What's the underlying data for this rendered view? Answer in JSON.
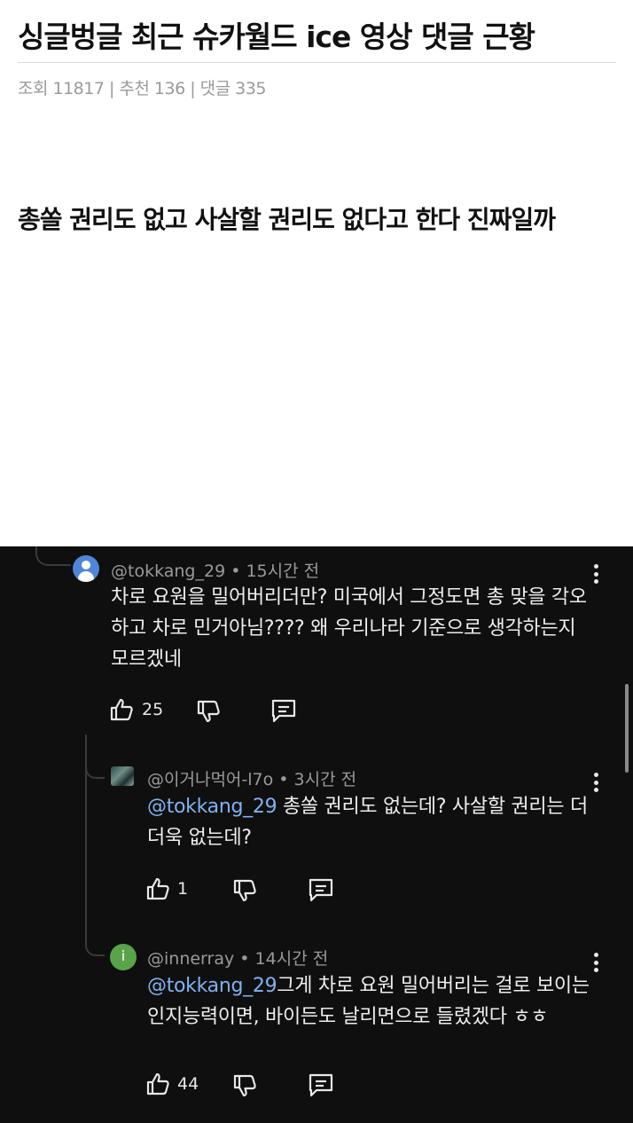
{
  "post": {
    "title": "싱글벙글 최근 슈카월드 ice 영상 댓글 근황",
    "meta": "조회 11817 | 추천 136 | 댓글 335",
    "body": "총쏠 권리도 없고 사살할 권리도 없다고 한다 진짜일까"
  },
  "comments": [
    {
      "handle": "@tokkang_29",
      "time": "15시간 전",
      "text": "차로 요원을 밀어버리더만? 미국에서 그정도면 총 맞을 각오 하고 차로 민거아님???? 왜 우리나라 기준으로 생각하는지 모르겠네",
      "likes": "25",
      "avatar_icon": "person-icon"
    },
    {
      "handle": "@이거나먹어-l7o",
      "time": "3시간 전",
      "mention": "@tokkang_29",
      "text": " 총쏠 권리도 없는데? 사살할 권리는 더더욱 없는데?",
      "likes": "1",
      "avatar_icon": "photo-avatar"
    },
    {
      "handle": "@innerray",
      "time": "14시간 전",
      "mention": "@tokkang_29",
      "text": "그게 차로 요원 밀어버리는 걸로 보이는 인지능력이면, 바이든도 날리면으로 들렸겠다 ㅎㅎ",
      "likes": "44",
      "avatar_letter": "i",
      "avatar_color": "#5aa34a"
    }
  ],
  "colors": {
    "background_dark": "#0f0f0f",
    "mention": "#7fb2f0",
    "meta_text": "#9a9a9a"
  }
}
